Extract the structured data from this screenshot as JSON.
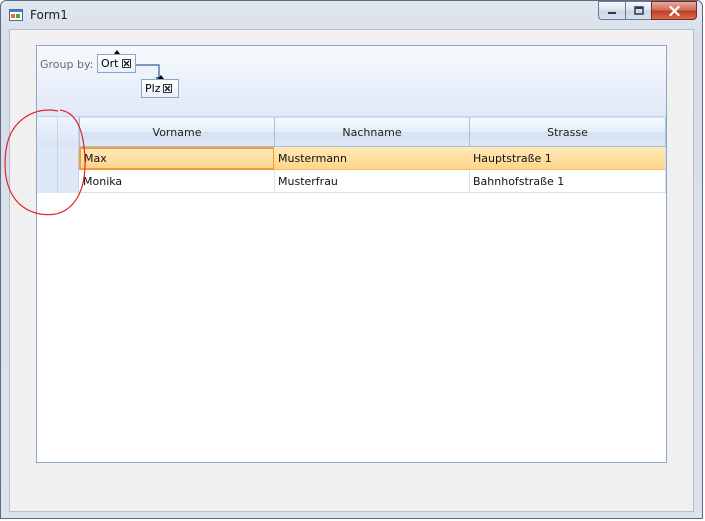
{
  "window": {
    "title": "Form1",
    "controls": {
      "minimize": "minimize",
      "maximize": "maximize",
      "close": "close"
    }
  },
  "group_panel": {
    "label": "Group by:",
    "groups": [
      {
        "label": "Ort"
      },
      {
        "label": "Plz"
      }
    ]
  },
  "grid": {
    "columns": [
      "Vorname",
      "Nachname",
      "Strasse"
    ],
    "rows": [
      {
        "vorname": "Max",
        "nachname": "Mustermann",
        "strasse": "Hauptstraße 1",
        "selected": true
      },
      {
        "vorname": "Monika",
        "nachname": "Musterfrau",
        "strasse": "Bahnhofstraße 1",
        "selected": false
      }
    ]
  },
  "colors": {
    "selection": "#ffd58a",
    "focus_border": "#f39a3c",
    "annotation": "#e0262a",
    "header_border": "#a9bfd9"
  },
  "icons": {
    "app": "windows-form-icon",
    "remove_group": "close-box-icon",
    "sort_ascending": "triangle-up-icon"
  }
}
